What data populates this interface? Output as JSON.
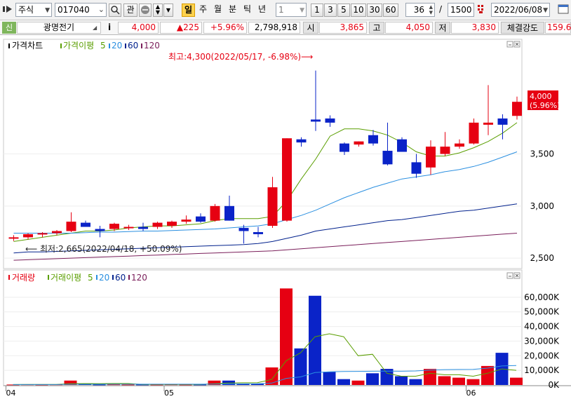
{
  "toolbar": {
    "market": "주식",
    "code": "017040",
    "gwan_label": "관",
    "periods": [
      "일",
      "주",
      "월",
      "분",
      "틱",
      "년"
    ],
    "selected_period": "일",
    "interval_value": "1",
    "minute_buttons": [
      "1",
      "3",
      "5",
      "10",
      "30",
      "60"
    ],
    "bar_count": "36",
    "separator": "/",
    "total_count": "1500",
    "date": "2022/06/08"
  },
  "quote": {
    "badge": "신",
    "name": "광명전기",
    "info_icon": "i",
    "price": "4,000",
    "change": "▲225",
    "change_rate": "+5.96%",
    "volume": "2,798,918",
    "open_label": "시",
    "open": "3,865",
    "high_label": "고",
    "high": "4,050",
    "low_label": "저",
    "low": "3,830",
    "strength_label": "체결강도",
    "strength": "159.6"
  },
  "price_panel": {
    "legend": {
      "title": "가격차트",
      "ma_prefix": "가격이평",
      "ma": [
        "5",
        "20",
        "60",
        "120"
      ]
    },
    "max_note": "최고:4,300(2022/05/17, -6.98%)⟶",
    "min_note": "⟵ 최저:2,665(2022/04/18, +50.09%)",
    "price_tag": "4,000",
    "price_tag_rate": "(5.96%)"
  },
  "volume_panel": {
    "legend": {
      "title": "거래량",
      "ma_prefix": "거래이평",
      "ma": [
        "5",
        "20",
        "60",
        "120"
      ]
    }
  },
  "x_axis_labels": [
    {
      "index": 0,
      "label": "04"
    },
    {
      "index": 11,
      "label": "05"
    },
    {
      "index": 32,
      "label": "06"
    }
  ],
  "colors": {
    "up": "#e60012",
    "down": "#0a23c8",
    "ma5": "#5a9e00",
    "ma20": "#2a8fe0",
    "ma60": "#00208c",
    "ma120": "#7a1e5a"
  },
  "chart_data": [
    {
      "type": "candlestick",
      "title": "가격차트",
      "ylim": [
        2400,
        4600
      ],
      "y_ticks": [
        2500,
        3000,
        3500
      ],
      "y_tick_labels": [
        "2,500",
        "3,000",
        "3,500"
      ],
      "candles": [
        {
          "o": 2700,
          "h": 2720,
          "l": 2665,
          "c": 2700
        },
        {
          "o": 2700,
          "h": 2740,
          "l": 2680,
          "c": 2730
        },
        {
          "o": 2730,
          "h": 2750,
          "l": 2700,
          "c": 2740
        },
        {
          "o": 2740,
          "h": 2770,
          "l": 2720,
          "c": 2760
        },
        {
          "o": 2760,
          "h": 2940,
          "l": 2750,
          "c": 2850
        },
        {
          "o": 2840,
          "h": 2860,
          "l": 2800,
          "c": 2800
        },
        {
          "o": 2780,
          "h": 2810,
          "l": 2700,
          "c": 2760
        },
        {
          "o": 2780,
          "h": 2840,
          "l": 2760,
          "c": 2830
        },
        {
          "o": 2790,
          "h": 2820,
          "l": 2770,
          "c": 2800
        },
        {
          "o": 2800,
          "h": 2840,
          "l": 2760,
          "c": 2780
        },
        {
          "o": 2800,
          "h": 2850,
          "l": 2780,
          "c": 2840
        },
        {
          "o": 2810,
          "h": 2860,
          "l": 2790,
          "c": 2850
        },
        {
          "o": 2850,
          "h": 2910,
          "l": 2830,
          "c": 2870
        },
        {
          "o": 2900,
          "h": 2930,
          "l": 2840,
          "c": 2850
        },
        {
          "o": 2860,
          "h": 3020,
          "l": 2850,
          "c": 3000
        },
        {
          "o": 3000,
          "h": 3100,
          "l": 2860,
          "c": 2860
        },
        {
          "o": 2790,
          "h": 2820,
          "l": 2640,
          "c": 2760
        },
        {
          "o": 2750,
          "h": 2800,
          "l": 2700,
          "c": 2730
        },
        {
          "o": 2810,
          "h": 3280,
          "l": 2790,
          "c": 3180
        },
        {
          "o": 2860,
          "h": 3650,
          "l": 2850,
          "c": 3650
        },
        {
          "o": 3640,
          "h": 3660,
          "l": 3570,
          "c": 3610
        },
        {
          "o": 3830,
          "h": 4300,
          "l": 3720,
          "c": 3810
        },
        {
          "o": 3840,
          "h": 3870,
          "l": 3760,
          "c": 3800
        },
        {
          "o": 3600,
          "h": 3610,
          "l": 3490,
          "c": 3520
        },
        {
          "o": 3590,
          "h": 3620,
          "l": 3570,
          "c": 3620
        },
        {
          "o": 3680,
          "h": 3730,
          "l": 3580,
          "c": 3600
        },
        {
          "o": 3530,
          "h": 3800,
          "l": 3390,
          "c": 3400
        },
        {
          "o": 3640,
          "h": 3660,
          "l": 3520,
          "c": 3520
        },
        {
          "o": 3420,
          "h": 3500,
          "l": 3270,
          "c": 3310
        },
        {
          "o": 3370,
          "h": 3630,
          "l": 3300,
          "c": 3570
        },
        {
          "o": 3500,
          "h": 3710,
          "l": 3480,
          "c": 3570
        },
        {
          "o": 3570,
          "h": 3640,
          "l": 3550,
          "c": 3600
        },
        {
          "o": 3600,
          "h": 3840,
          "l": 3590,
          "c": 3800
        },
        {
          "o": 3780,
          "h": 4160,
          "l": 3680,
          "c": 3800
        },
        {
          "o": 3840,
          "h": 3880,
          "l": 3640,
          "c": 3780
        },
        {
          "o": 3865,
          "h": 4050,
          "l": 3830,
          "c": 4000
        }
      ],
      "series": [
        {
          "name": "5",
          "values": [
            2660,
            2680,
            2700,
            2720,
            2740,
            2760,
            2760,
            2770,
            2790,
            2800,
            2810,
            2810,
            2820,
            2830,
            2860,
            2880,
            2880,
            2880,
            2900,
            3050,
            3260,
            3450,
            3670,
            3740,
            3740,
            3720,
            3680,
            3610,
            3520,
            3480,
            3480,
            3510,
            3560,
            3620,
            3700,
            3800
          ]
        },
        {
          "name": "20",
          "values": [
            2740,
            2740,
            2740,
            2740,
            2740,
            2745,
            2750,
            2750,
            2755,
            2760,
            2760,
            2765,
            2770,
            2775,
            2780,
            2790,
            2800,
            2810,
            2830,
            2870,
            2910,
            2960,
            3020,
            3080,
            3130,
            3180,
            3220,
            3260,
            3280,
            3300,
            3330,
            3350,
            3380,
            3420,
            3470,
            3520
          ]
        },
        {
          "name": "60",
          "values": [
            2550,
            2560,
            2560,
            2565,
            2570,
            2575,
            2580,
            2585,
            2590,
            2595,
            2600,
            2605,
            2610,
            2615,
            2620,
            2625,
            2630,
            2640,
            2660,
            2690,
            2720,
            2760,
            2780,
            2800,
            2820,
            2840,
            2860,
            2870,
            2890,
            2910,
            2930,
            2950,
            2960,
            2980,
            3000,
            3020
          ]
        },
        {
          "name": "120",
          "values": [
            2480,
            2485,
            2490,
            2495,
            2500,
            2505,
            2510,
            2515,
            2520,
            2525,
            2530,
            2535,
            2540,
            2545,
            2550,
            2555,
            2560,
            2565,
            2570,
            2580,
            2590,
            2600,
            2610,
            2620,
            2630,
            2640,
            2650,
            2660,
            2670,
            2680,
            2690,
            2700,
            2710,
            2720,
            2730,
            2740
          ]
        }
      ]
    },
    {
      "type": "bar",
      "title": "거래량",
      "ylim": [
        0,
        70000
      ],
      "y_ticks": [
        0,
        10000,
        20000,
        30000,
        40000,
        50000,
        60000
      ],
      "y_tick_labels": [
        "0K",
        "10,000K",
        "20,000K",
        "30,000K",
        "40,000K",
        "50,000K",
        "60,000K"
      ],
      "values": [
        300,
        400,
        300,
        400,
        3000,
        600,
        300,
        400,
        300,
        300,
        300,
        400,
        300,
        300,
        3000,
        3000,
        1000,
        800,
        12000,
        66000,
        25000,
        61000,
        9000,
        4000,
        3000,
        8000,
        11000,
        6000,
        4000,
        11000,
        6000,
        5000,
        4000,
        13000,
        22000,
        5000,
        2800
      ],
      "series": [
        {
          "name": "5",
          "values": [
            300,
            350,
            350,
            360,
            900,
            940,
            920,
            1000,
            1000,
            400,
            320,
            340,
            320,
            320,
            860,
            1400,
            1500,
            1600,
            3800,
            16600,
            22000,
            33000,
            35000,
            33000,
            20000,
            21000,
            8000,
            6000,
            6000,
            8000,
            7000,
            7000,
            6000,
            8000,
            11000,
            10000,
            9000
          ]
        },
        {
          "name": "20",
          "values": [
            300,
            300,
            300,
            300,
            500,
            500,
            500,
            520,
            520,
            520,
            520,
            520,
            520,
            520,
            600,
            700,
            700,
            800,
            1300,
            4500,
            5500,
            8500,
            9000,
            9200,
            9300,
            9400,
            9500,
            9400,
            9600,
            10200,
            10500,
            10600,
            10700,
            11500,
            13000,
            13300,
            13300
          ]
        }
      ]
    }
  ]
}
